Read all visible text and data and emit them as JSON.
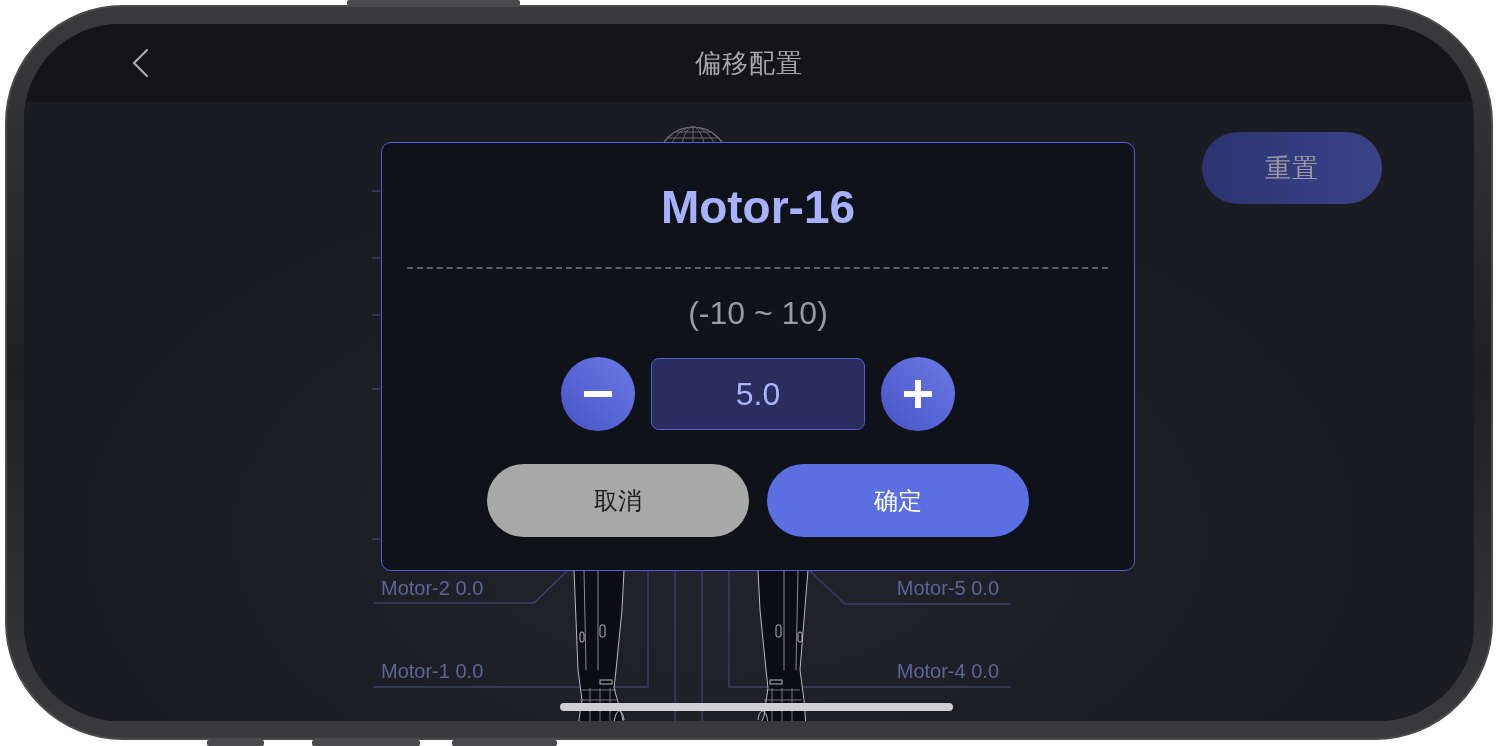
{
  "nav_bar": {
    "title": "偏移配置"
  },
  "reset_button": {
    "label": "重置"
  },
  "motor_labels": [
    "Motor-2 0.0",
    "Motor-1 0.0",
    "Motor-5 0.0",
    "Motor-4 0.0"
  ],
  "dialog": {
    "title": "Motor-16",
    "range": "(-10 ~ 10)",
    "value": "5.0",
    "buttons": [
      {
        "label": "取消",
        "kind": "cancel"
      },
      {
        "label": "确定",
        "kind": "confirm"
      }
    ]
  }
}
